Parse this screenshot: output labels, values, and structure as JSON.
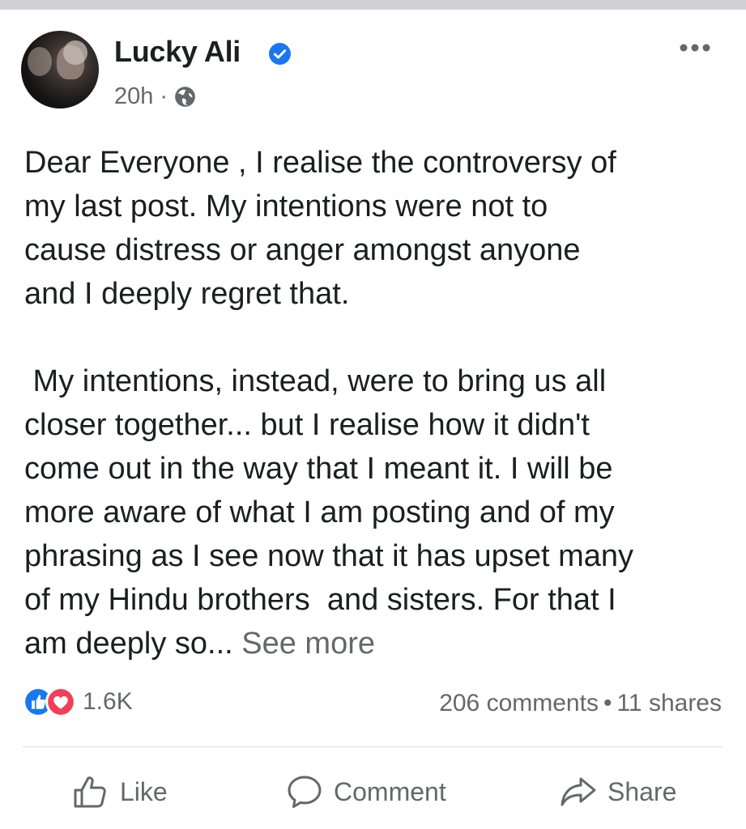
{
  "post": {
    "author": "Lucky Ali",
    "verified": true,
    "time": "20h",
    "meta_separator": "·",
    "privacy_icon": "globe-icon",
    "body_paragraphs": [
      [
        "Dear Everyone , I realise the controversy of",
        "my last post. My intentions were not to",
        "cause distress or anger amongst anyone",
        "and I deeply regret that."
      ],
      [
        " My intentions, instead, were to bring us all",
        "closer together... but I realise how it didn't",
        "come out in the way that I meant it. I will be",
        "more aware of what I am posting and of my",
        "phrasing as I see now that it has upset many",
        "of my Hindu brothers  and sisters. For that I",
        "am deeply so..."
      ]
    ],
    "see_more": "See more"
  },
  "stats": {
    "reaction_icons": [
      "like-reaction-icon",
      "love-reaction-icon"
    ],
    "reaction_count": "1.6K",
    "comments": "206 comments",
    "separator": "•",
    "shares": "11 shares"
  },
  "actions": {
    "like_label": "Like",
    "comment_label": "Comment",
    "share_label": "Share"
  },
  "colors": {
    "verified": "#1877f2",
    "like_reaction": "#1877f2",
    "love_reaction": "#f33e58",
    "secondary_text": "#65676b"
  }
}
